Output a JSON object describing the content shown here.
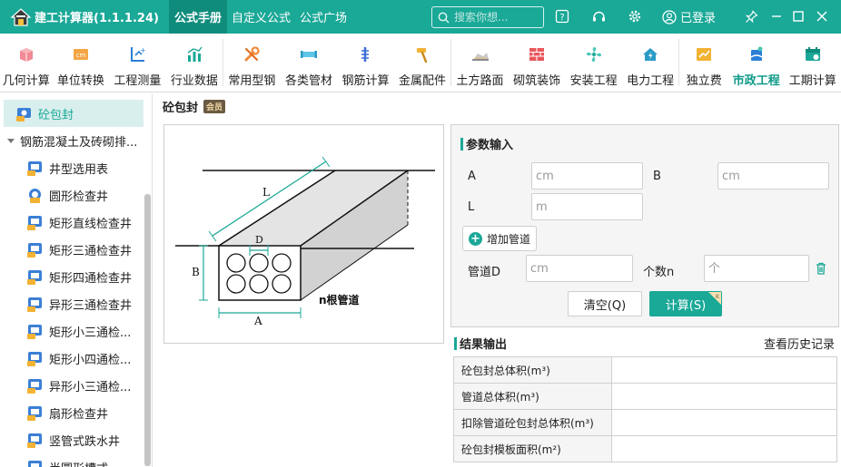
{
  "app": {
    "title": "建工计算器(1.1.1.24)",
    "accent": "#1aa897",
    "nav": [
      "公式手册",
      "自定义公式",
      "公式广场"
    ],
    "search_placeholder": "搜索你想...",
    "login": "已登录"
  },
  "toolbar": [
    {
      "label": "几何计算",
      "icon": "cube-icon"
    },
    {
      "label": "单位转换",
      "icon": "unit-convert-icon"
    },
    {
      "label": "工程测量",
      "icon": "measure-icon"
    },
    {
      "label": "行业数据",
      "icon": "bar-chart-icon"
    },
    {
      "label": "常用型钢",
      "icon": "wrench-icon"
    },
    {
      "label": "各类管材",
      "icon": "pipe-icon"
    },
    {
      "label": "钢筋计算",
      "icon": "rebar-icon"
    },
    {
      "label": "金属配件",
      "icon": "hammer-icon"
    },
    {
      "label": "土方路面",
      "icon": "earthwork-icon"
    },
    {
      "label": "砌筑装饰",
      "icon": "brick-wall-icon"
    },
    {
      "label": "安装工程",
      "icon": "fan-icon"
    },
    {
      "label": "电力工程",
      "icon": "house-power-icon"
    },
    {
      "label": "独立费",
      "icon": "fee-icon"
    },
    {
      "label": "市政工程",
      "icon": "municipal-icon"
    },
    {
      "label": "工期计算",
      "icon": "calendar-icon"
    }
  ],
  "sidebar": {
    "top_item": "砼包封",
    "group": "钢筋混凝土及砖砌排...",
    "items": [
      "井型选用表",
      "圆形检查井",
      "矩形直线检查井",
      "矩形三通检查井",
      "矩形四通检查井",
      "异形三通检查井",
      "矩形小三通检...",
      "矩形小四通检...",
      "异形小三通检...",
      "扇形检查井",
      "竖管式跌水井",
      "半圆形槽式..."
    ]
  },
  "main": {
    "title": "砼包封",
    "vip": "会员",
    "diagram": {
      "L": "L",
      "B": "B",
      "D": "D",
      "A": "A",
      "caption": "n根管道"
    }
  },
  "params": {
    "title": "参数输入",
    "A_label": "A",
    "A_placeholder": "cm",
    "B_label": "B",
    "B_placeholder": "cm",
    "L_label": "L",
    "L_placeholder": "m",
    "add_pipe": "增加管道",
    "D_label": "管道D",
    "D_placeholder": "cm",
    "n_label": "个数n",
    "n_placeholder": "个",
    "clear": "清空(Q)",
    "calc": "计算(S)"
  },
  "results": {
    "title": "结果输出",
    "history": "查看历史记录",
    "rows": [
      {
        "label": "砼包封总体积(m³)",
        "value": ""
      },
      {
        "label": "管道总体积(m³)",
        "value": ""
      },
      {
        "label": "扣除管道砼包封总体积(m³)",
        "value": ""
      },
      {
        "label": "砼包封模板面积(m²)",
        "value": ""
      }
    ]
  }
}
